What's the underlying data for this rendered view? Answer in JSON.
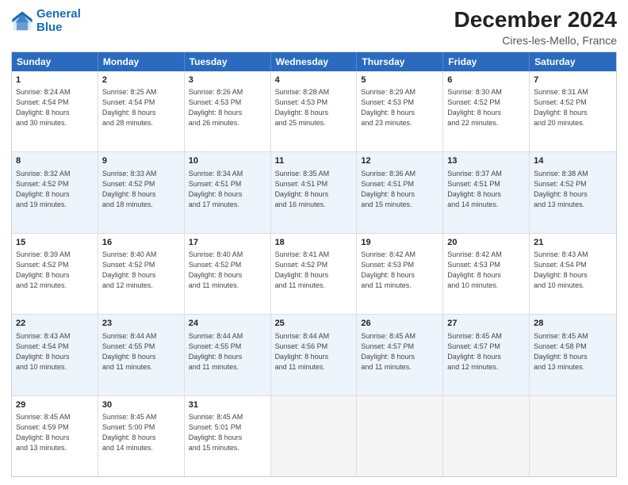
{
  "header": {
    "logo_line1": "General",
    "logo_line2": "Blue",
    "month_title": "December 2024",
    "location": "Cires-les-Mello, France"
  },
  "days_of_week": [
    "Sunday",
    "Monday",
    "Tuesday",
    "Wednesday",
    "Thursday",
    "Friday",
    "Saturday"
  ],
  "weeks": [
    [
      {
        "day": "1",
        "info": "Sunrise: 8:24 AM\nSunset: 4:54 PM\nDaylight: 8 hours\nand 30 minutes."
      },
      {
        "day": "2",
        "info": "Sunrise: 8:25 AM\nSunset: 4:54 PM\nDaylight: 8 hours\nand 28 minutes."
      },
      {
        "day": "3",
        "info": "Sunrise: 8:26 AM\nSunset: 4:53 PM\nDaylight: 8 hours\nand 26 minutes."
      },
      {
        "day": "4",
        "info": "Sunrise: 8:28 AM\nSunset: 4:53 PM\nDaylight: 8 hours\nand 25 minutes."
      },
      {
        "day": "5",
        "info": "Sunrise: 8:29 AM\nSunset: 4:53 PM\nDaylight: 8 hours\nand 23 minutes."
      },
      {
        "day": "6",
        "info": "Sunrise: 8:30 AM\nSunset: 4:52 PM\nDaylight: 8 hours\nand 22 minutes."
      },
      {
        "day": "7",
        "info": "Sunrise: 8:31 AM\nSunset: 4:52 PM\nDaylight: 8 hours\nand 20 minutes."
      }
    ],
    [
      {
        "day": "8",
        "info": "Sunrise: 8:32 AM\nSunset: 4:52 PM\nDaylight: 8 hours\nand 19 minutes."
      },
      {
        "day": "9",
        "info": "Sunrise: 8:33 AM\nSunset: 4:52 PM\nDaylight: 8 hours\nand 18 minutes."
      },
      {
        "day": "10",
        "info": "Sunrise: 8:34 AM\nSunset: 4:51 PM\nDaylight: 8 hours\nand 17 minutes."
      },
      {
        "day": "11",
        "info": "Sunrise: 8:35 AM\nSunset: 4:51 PM\nDaylight: 8 hours\nand 16 minutes."
      },
      {
        "day": "12",
        "info": "Sunrise: 8:36 AM\nSunset: 4:51 PM\nDaylight: 8 hours\nand 15 minutes."
      },
      {
        "day": "13",
        "info": "Sunrise: 8:37 AM\nSunset: 4:51 PM\nDaylight: 8 hours\nand 14 minutes."
      },
      {
        "day": "14",
        "info": "Sunrise: 8:38 AM\nSunset: 4:52 PM\nDaylight: 8 hours\nand 13 minutes."
      }
    ],
    [
      {
        "day": "15",
        "info": "Sunrise: 8:39 AM\nSunset: 4:52 PM\nDaylight: 8 hours\nand 12 minutes."
      },
      {
        "day": "16",
        "info": "Sunrise: 8:40 AM\nSunset: 4:52 PM\nDaylight: 8 hours\nand 12 minutes."
      },
      {
        "day": "17",
        "info": "Sunrise: 8:40 AM\nSunset: 4:52 PM\nDaylight: 8 hours\nand 11 minutes."
      },
      {
        "day": "18",
        "info": "Sunrise: 8:41 AM\nSunset: 4:52 PM\nDaylight: 8 hours\nand 11 minutes."
      },
      {
        "day": "19",
        "info": "Sunrise: 8:42 AM\nSunset: 4:53 PM\nDaylight: 8 hours\nand 11 minutes."
      },
      {
        "day": "20",
        "info": "Sunrise: 8:42 AM\nSunset: 4:53 PM\nDaylight: 8 hours\nand 10 minutes."
      },
      {
        "day": "21",
        "info": "Sunrise: 8:43 AM\nSunset: 4:54 PM\nDaylight: 8 hours\nand 10 minutes."
      }
    ],
    [
      {
        "day": "22",
        "info": "Sunrise: 8:43 AM\nSunset: 4:54 PM\nDaylight: 8 hours\nand 10 minutes."
      },
      {
        "day": "23",
        "info": "Sunrise: 8:44 AM\nSunset: 4:55 PM\nDaylight: 8 hours\nand 11 minutes."
      },
      {
        "day": "24",
        "info": "Sunrise: 8:44 AM\nSunset: 4:55 PM\nDaylight: 8 hours\nand 11 minutes."
      },
      {
        "day": "25",
        "info": "Sunrise: 8:44 AM\nSunset: 4:56 PM\nDaylight: 8 hours\nand 11 minutes."
      },
      {
        "day": "26",
        "info": "Sunrise: 8:45 AM\nSunset: 4:57 PM\nDaylight: 8 hours\nand 11 minutes."
      },
      {
        "day": "27",
        "info": "Sunrise: 8:45 AM\nSunset: 4:57 PM\nDaylight: 8 hours\nand 12 minutes."
      },
      {
        "day": "28",
        "info": "Sunrise: 8:45 AM\nSunset: 4:58 PM\nDaylight: 8 hours\nand 13 minutes."
      }
    ],
    [
      {
        "day": "29",
        "info": "Sunrise: 8:45 AM\nSunset: 4:59 PM\nDaylight: 8 hours\nand 13 minutes."
      },
      {
        "day": "30",
        "info": "Sunrise: 8:45 AM\nSunset: 5:00 PM\nDaylight: 8 hours\nand 14 minutes."
      },
      {
        "day": "31",
        "info": "Sunrise: 8:45 AM\nSunset: 5:01 PM\nDaylight: 8 hours\nand 15 minutes."
      },
      {
        "day": "",
        "info": ""
      },
      {
        "day": "",
        "info": ""
      },
      {
        "day": "",
        "info": ""
      },
      {
        "day": "",
        "info": ""
      }
    ]
  ]
}
